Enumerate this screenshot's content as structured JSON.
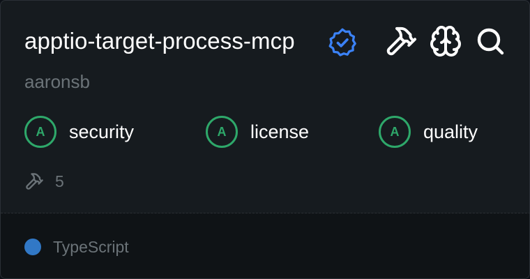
{
  "server": {
    "name": "apptio-target-process-mcp",
    "author": "aaronsb",
    "verified_icon": "verified-badge-icon"
  },
  "actions": [
    {
      "icon": "hammer-icon"
    },
    {
      "icon": "brain-icon"
    },
    {
      "icon": "search-icon"
    }
  ],
  "scores": [
    {
      "grade": "A",
      "label": "security"
    },
    {
      "grade": "A",
      "label": "license"
    },
    {
      "grade": "A",
      "label": "quality"
    }
  ],
  "tools": {
    "icon": "hammer-icon",
    "count": "5"
  },
  "language": {
    "name": "TypeScript",
    "color": "#3178c6"
  },
  "colors": {
    "grade": "#2ea86a",
    "verified": "#3b82f6",
    "muted_text": "#6b7378"
  }
}
